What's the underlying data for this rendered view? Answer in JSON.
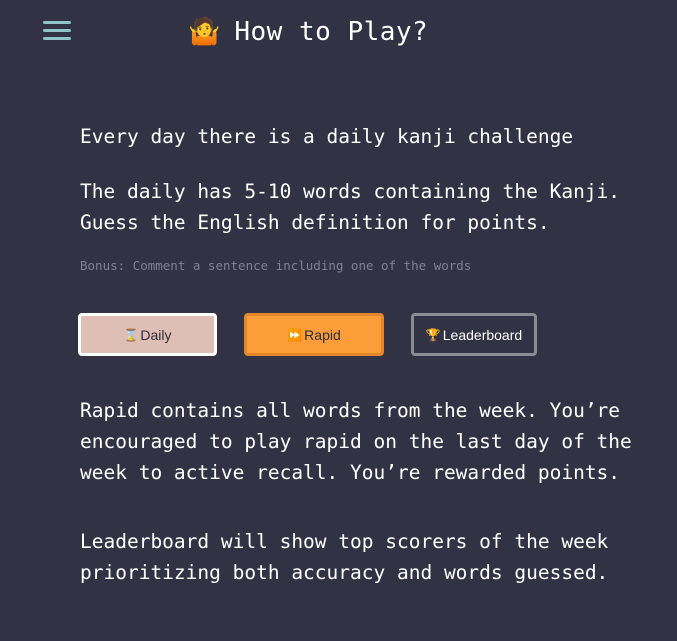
{
  "header": {
    "menu_icon": "hamburger-menu-icon",
    "emoji": "🤷",
    "title": "How to Play?"
  },
  "content": {
    "intro": "Every day there is a daily kanji challenge",
    "daily_desc": "The daily has 5-10 words containing the Kanji.\nGuess the English definition for points.",
    "bonus": "Bonus: Comment a sentence including one of the words",
    "rapid_desc": "Rapid contains all words from the week. You’re\nencouraged to play rapid on the last day of the\nweek to active recall. You’re rewarded points.",
    "leaderboard_desc": "Leaderboard will show top scorers of the week\nprioritizing both accuracy and words guessed."
  },
  "buttons": {
    "daily": {
      "icon": "⌛",
      "label": "Daily"
    },
    "rapid": {
      "icon": "⏩",
      "label": "Rapid"
    },
    "leaderboard": {
      "icon": "🏆",
      "label": "Leaderboard"
    }
  },
  "colors": {
    "background": "#313244",
    "menu_icon": "#8fc3c8",
    "daily_bg": "#dfbfb5",
    "rapid_bg": "#fc9d3a",
    "leaderboard_border": "#8a8b94",
    "bonus_text": "#7f8294"
  }
}
